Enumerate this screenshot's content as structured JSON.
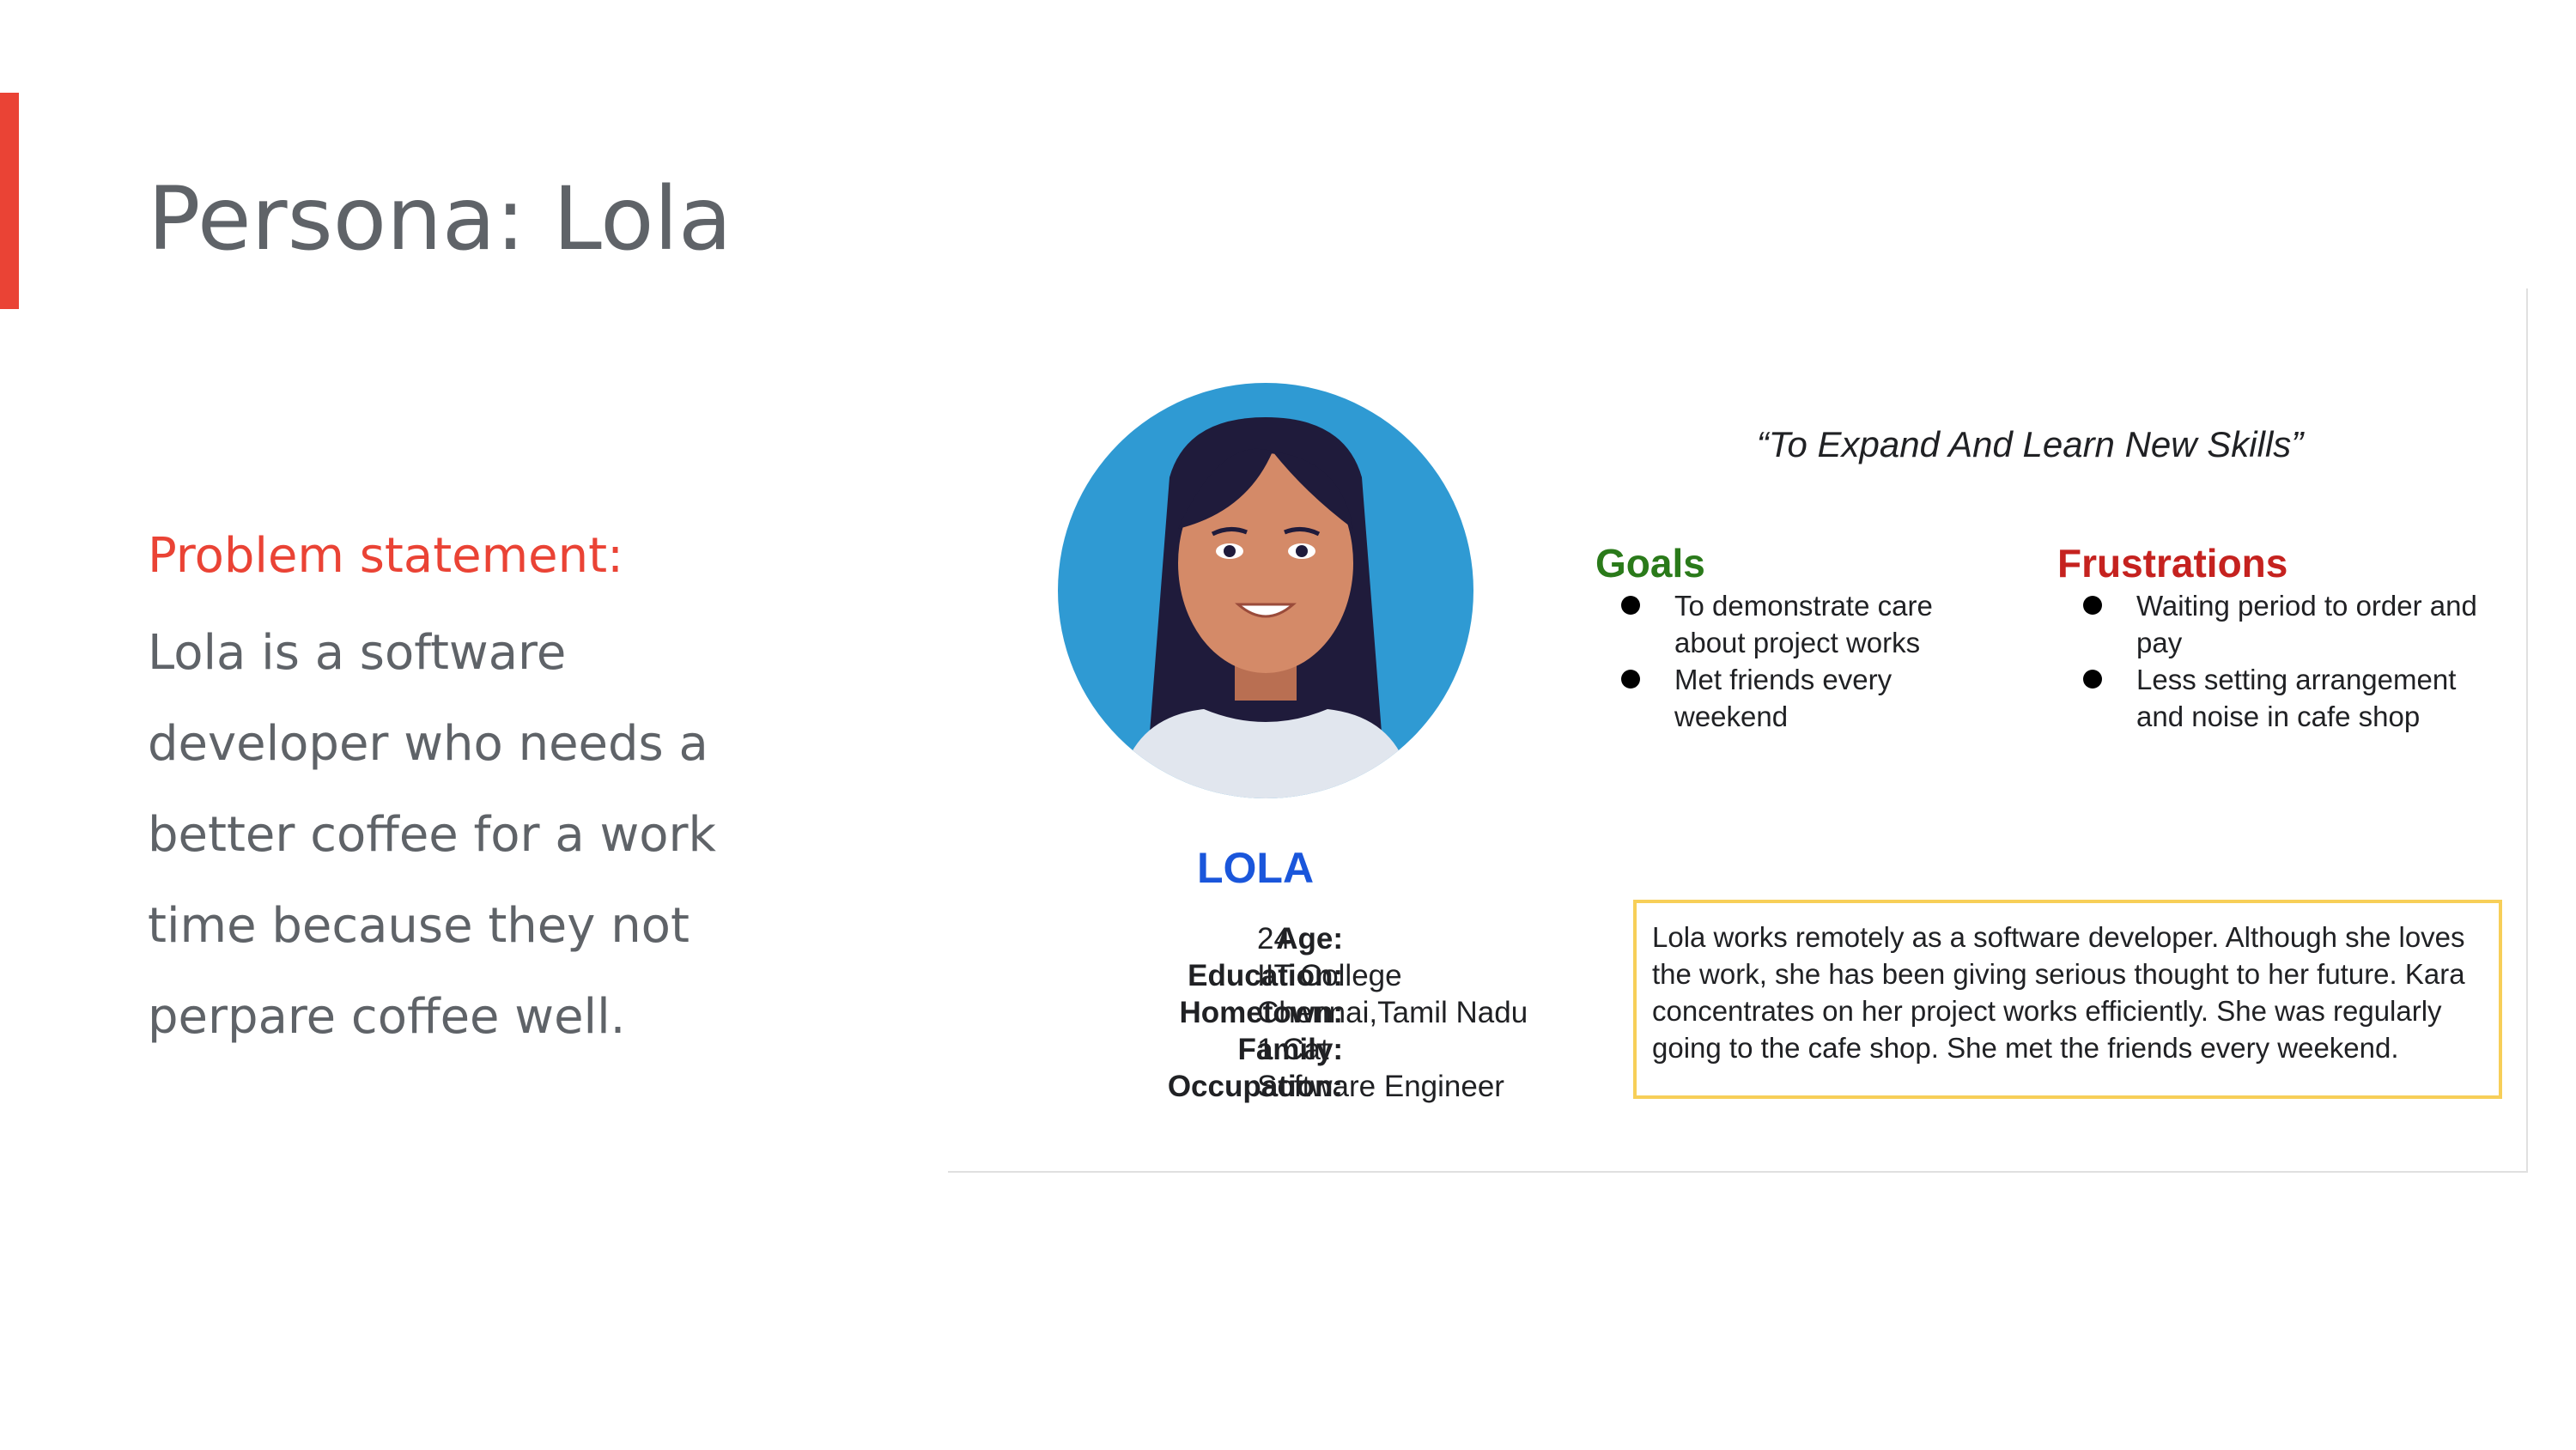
{
  "slide": {
    "title": "Persona: Lola",
    "accent_color": "#ea4335",
    "problem_heading": "Problem statement:",
    "problem_text": "Lola is a software developer who needs a better coffee for a work time because they not perpare coffee well."
  },
  "persona": {
    "name": "LOLA",
    "quote": "“To Expand And Learn New Skills”",
    "details": [
      {
        "label": "Age:",
        "value": "24"
      },
      {
        "label": "Education:",
        "value": "IIT College"
      },
      {
        "label": "Hometown:",
        "value": "Chennai,Tamil Nadu"
      },
      {
        "label": "Family:",
        "value": "1 Cat"
      },
      {
        "label": "Occupation:",
        "value": "Software Engineer"
      }
    ],
    "goals": {
      "heading": "Goals",
      "items": [
        "To demonstrate care about project works",
        "Met friends every weekend"
      ]
    },
    "frustrations": {
      "heading": "Frustrations",
      "items": [
        "Waiting period to order and pay",
        "Less setting arrangement and noise in cafe shop"
      ]
    },
    "bio": "Lola  works remotely as a software developer. Although she loves the work, she has been giving serious thought to her future. Kara concentrates on her project works efficiently. She was regularly going to the cafe shop. She met the friends every weekend."
  }
}
